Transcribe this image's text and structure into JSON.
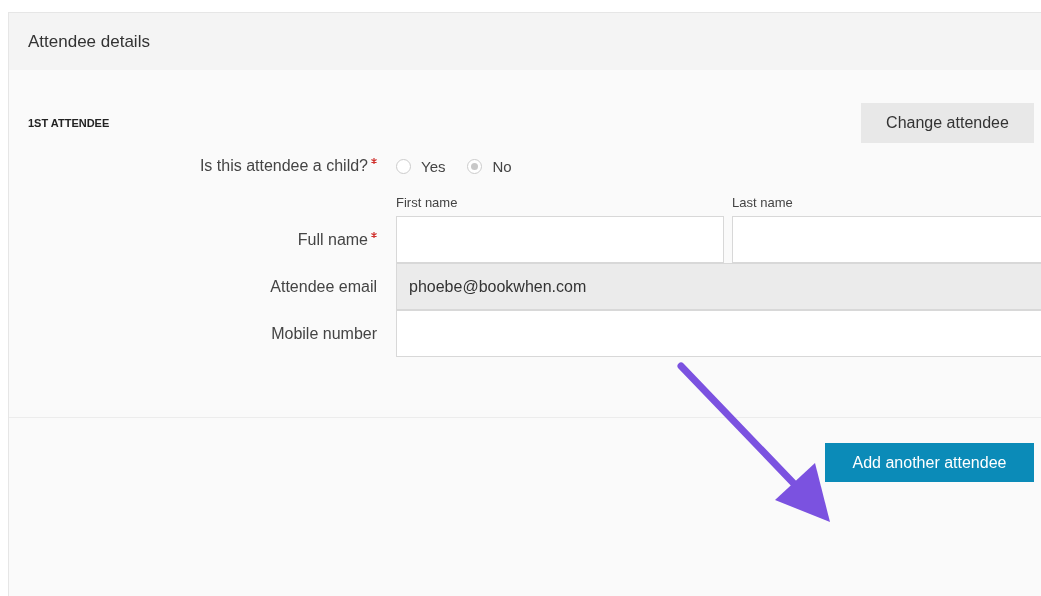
{
  "panel": {
    "title": "Attendee details"
  },
  "attendee": {
    "heading": "1ST ATTENDEE",
    "change_button": "Change attendee"
  },
  "child_question": {
    "label": "Is this attendee a child?",
    "required": true,
    "options": [
      {
        "label": "Yes",
        "selected": false
      },
      {
        "label": "No",
        "selected": true
      }
    ]
  },
  "full_name": {
    "label": "Full name",
    "required": true,
    "fields": [
      {
        "caption": "First name"
      },
      {
        "caption": "Last name"
      }
    ]
  },
  "email": {
    "label": "Attendee email",
    "value": "phoebe@bookwhen.com",
    "disabled": true
  },
  "mobile": {
    "label": "Mobile number"
  },
  "add_button": "Add another attendee"
}
